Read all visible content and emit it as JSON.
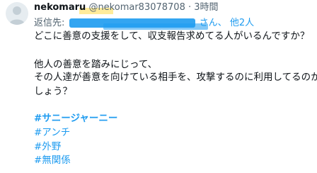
{
  "tweet": {
    "display_name": "nekomaru",
    "handle": "@nekomar83078708",
    "separator": "·",
    "time": "3時間",
    "reply_prefix": "返信先:",
    "reply_suffix": "さん、",
    "reply_others": "他2人",
    "body_lines": [
      "どこに善意の支援をして、収支報告求めてる人がいるんですか？",
      "他人の善意を踏みにじって、",
      "その人達が善意を向けている相手を、攻撃するのに利用してるのか",
      "しょう？"
    ],
    "hashtags": [
      "#サニージャーニー",
      "#アンチ",
      "#外野",
      "#無関係"
    ]
  },
  "colors": {
    "link": "#1d9bf0",
    "secondary": "#536471",
    "text": "#0f1419",
    "highlight": "#ffe98a"
  }
}
